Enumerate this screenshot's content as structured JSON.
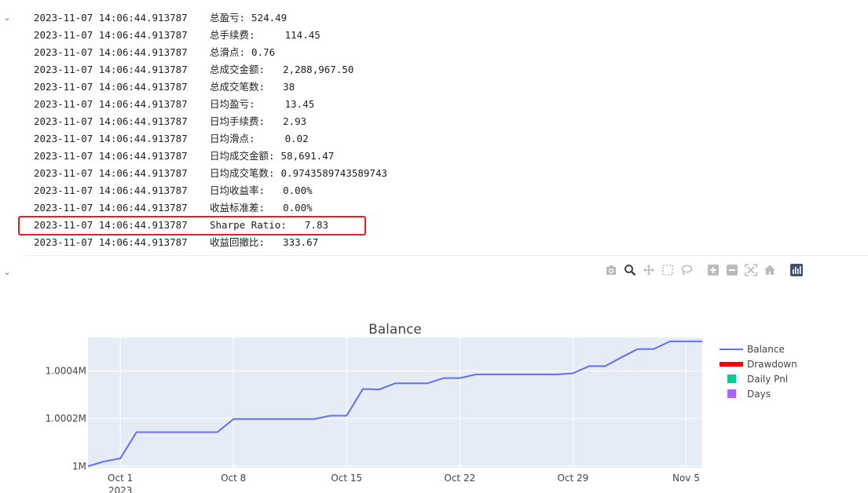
{
  "log_lines": [
    {
      "timestamp": "2023-11-07 14:06:44.913787",
      "label": "总盈亏:",
      "value": "524.49"
    },
    {
      "timestamp": "2023-11-07 14:06:44.913787",
      "label": "总手续费:",
      "value": "    114.45"
    },
    {
      "timestamp": "2023-11-07 14:06:44.913787",
      "label": "总滑点:",
      "value": "0.76"
    },
    {
      "timestamp": "2023-11-07 14:06:44.913787",
      "label": "总成交金额:",
      "value": "  2,288,967.50"
    },
    {
      "timestamp": "2023-11-07 14:06:44.913787",
      "label": "总成交笔数:",
      "value": "  38"
    },
    {
      "timestamp": "2023-11-07 14:06:44.913787",
      "label": "日均盈亏:",
      "value": "    13.45"
    },
    {
      "timestamp": "2023-11-07 14:06:44.913787",
      "label": "日均手续费:",
      "value": "  2.93"
    },
    {
      "timestamp": "2023-11-07 14:06:44.913787",
      "label": "日均滑点:",
      "value": "    0.02"
    },
    {
      "timestamp": "2023-11-07 14:06:44.913787",
      "label": "日均成交金额:",
      "value": "58,691.47"
    },
    {
      "timestamp": "2023-11-07 14:06:44.913787",
      "label": "日均成交笔数:",
      "value": "0.9743589743589743"
    },
    {
      "timestamp": "2023-11-07 14:06:44.913787",
      "label": "日均收益率:",
      "value": "  0.00%"
    },
    {
      "timestamp": "2023-11-07 14:06:44.913787",
      "label": "收益标准差:",
      "value": "  0.00%"
    },
    {
      "timestamp": "2023-11-07 14:06:44.913787",
      "label": "Sharpe Ratio:",
      "value": "  7.83"
    },
    {
      "timestamp": "2023-11-07 14:06:44.913787",
      "label": "收益回撤比:",
      "value": "  333.67"
    }
  ],
  "highlighted_line_index": 12,
  "modebar": {
    "icons": [
      "camera-icon",
      "zoom-icon",
      "pan-icon",
      "box-select-icon",
      "lasso-select-icon",
      "zoom-in-icon",
      "zoom-out-icon",
      "autoscale-icon",
      "reset-axes-icon",
      "plotly-logo-icon"
    ],
    "color": "#bbbbbb",
    "active_color": "#444444",
    "logo_color": "#3f4f75"
  },
  "colors": {
    "plot_bg": "#e5ecf6",
    "grid": "#ffffff",
    "balance": "#636efa",
    "drawdown": "#ff0000",
    "daily_pnl": "#00cc96",
    "days": "#ab63fa",
    "highlight": "#e02222"
  },
  "chart_data": {
    "type": "line",
    "title": "Balance",
    "x_ticks": [
      "Oct 1",
      "Oct 8",
      "Oct 15",
      "Oct 22",
      "Oct 29",
      "Nov 5"
    ],
    "x_tick_year": "2023",
    "y_ticks": [
      "1M",
      "1.0002M",
      "1.0004M"
    ],
    "ylim": [
      999993,
      1000540
    ],
    "xlim": [
      "2023-09-29",
      "2023-11-06"
    ],
    "grid": true,
    "legend_position": "right",
    "series": [
      {
        "name": "Balance",
        "type": "line",
        "x": [
          "2023-09-29",
          "2023-09-30",
          "2023-10-01",
          "2023-10-02",
          "2023-10-03",
          "2023-10-04",
          "2023-10-05",
          "2023-10-06",
          "2023-10-07",
          "2023-10-08",
          "2023-10-09",
          "2023-10-10",
          "2023-10-11",
          "2023-10-12",
          "2023-10-13",
          "2023-10-14",
          "2023-10-15",
          "2023-10-16",
          "2023-10-17",
          "2023-10-18",
          "2023-10-19",
          "2023-10-20",
          "2023-10-21",
          "2023-10-22",
          "2023-10-23",
          "2023-10-24",
          "2023-10-25",
          "2023-10-26",
          "2023-10-27",
          "2023-10-28",
          "2023-10-29",
          "2023-10-30",
          "2023-10-31",
          "2023-11-01",
          "2023-11-02",
          "2023-11-03",
          "2023-11-04",
          "2023-11-05",
          "2023-11-06"
        ],
        "y": [
          1000000,
          1000020,
          1000033,
          1000143,
          1000143,
          1000143,
          1000143,
          1000143,
          1000143,
          1000198,
          1000198,
          1000198,
          1000198,
          1000198,
          1000198,
          1000212,
          1000212,
          1000324,
          1000322,
          1000348,
          1000348,
          1000348,
          1000370,
          1000370,
          1000385,
          1000385,
          1000385,
          1000385,
          1000385,
          1000385,
          1000390,
          1000420,
          1000420,
          1000457,
          1000492,
          1000492,
          1000524,
          1000524,
          1000524
        ]
      },
      {
        "name": "Drawdown"
      },
      {
        "name": "Daily Pnl"
      },
      {
        "name": "Days"
      }
    ]
  }
}
